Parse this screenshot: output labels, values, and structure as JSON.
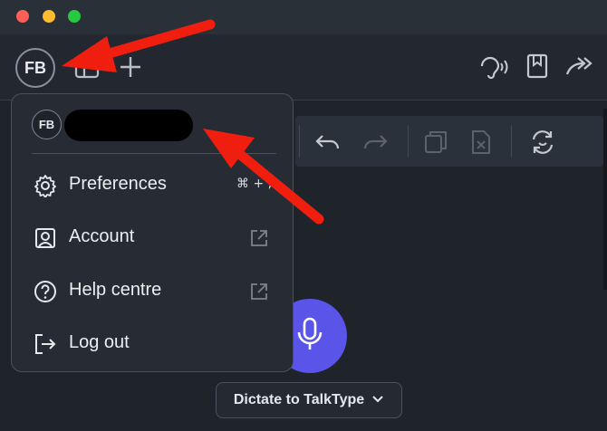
{
  "window": {
    "controls": [
      "close",
      "minimize",
      "zoom"
    ],
    "colors": {
      "close": "#fe5f57",
      "minimize": "#febc2e",
      "zoom": "#28c840"
    }
  },
  "toolbar": {
    "avatar_initials": "FB",
    "icons": [
      "sidebar-icon",
      "plus-icon",
      "voice-icon",
      "bookmark-icon",
      "share-icon"
    ]
  },
  "edit_toolbar": {
    "icons": [
      "undo-icon",
      "redo-icon",
      "copy-icon",
      "clear-icon",
      "refresh-icon"
    ]
  },
  "menu": {
    "avatar_initials": "FB",
    "items": [
      {
        "label": "Preferences",
        "icon": "gear-icon",
        "shortcut": "⌘ + ,"
      },
      {
        "label": "Account",
        "icon": "user-icon",
        "right_icon": "external-link-icon"
      },
      {
        "label": "Help centre",
        "icon": "help-icon",
        "right_icon": "external-link-icon"
      },
      {
        "label": "Log out",
        "icon": "logout-icon"
      }
    ]
  },
  "dictate": {
    "label": "Dictate to TalkType",
    "icon": "chevron-down-icon"
  },
  "colors": {
    "accent": "#5a55e8",
    "annotation_arrow": "#f01e0f",
    "background": "#1f242b"
  }
}
